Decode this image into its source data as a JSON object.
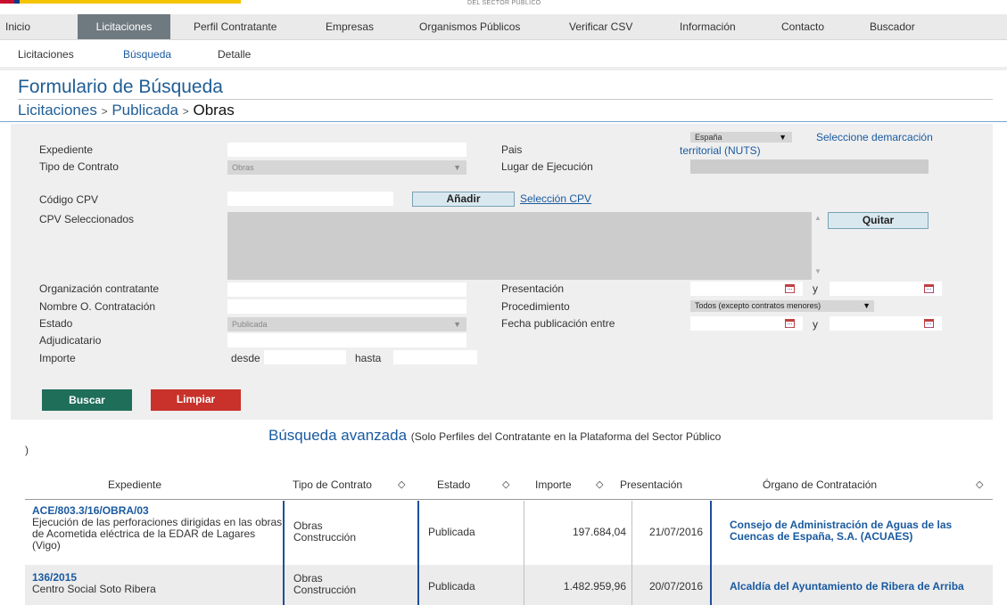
{
  "header": {
    "top_text": "DEL SECTOR PÚBLICO"
  },
  "main_nav": [
    "Inicio",
    "Licitaciones",
    "Perfil Contratante",
    "Empresas",
    "Organismos Públicos",
    "Verificar CSV",
    "Información",
    "Contacto",
    "Buscador"
  ],
  "sub_nav": [
    "Licitaciones",
    "Búsqueda",
    "Detalle"
  ],
  "page": {
    "title": "Formulario de Búsqueda",
    "breadcrumb": [
      "Licitaciones",
      "Publicada",
      "Obras"
    ],
    "breadcrumb_sep": ">"
  },
  "form": {
    "expediente_label": "Expediente",
    "tipo_label": "Tipo de Contrato",
    "tipo_value": "Obras",
    "cpv_label": "Código CPV",
    "cpv_sel_label": "CPV Seleccionados",
    "add_button": "Añadir",
    "cpv_link": "Selección CPV",
    "remove_button": "Quitar",
    "pais_label": "Pais",
    "pais_value": "España",
    "demarcacion_link_1": "Seleccione demarcación",
    "demarcacion_link_2": "territorial (NUTS)",
    "lugar_label": "Lugar de Ejecución",
    "org_label": "Organización contratante",
    "nombre_label": "Nombre O. Contratación",
    "estado_label": "Estado",
    "estado_value": "Publicada",
    "adj_label": "Adjudicatario",
    "importe_label": "Importe",
    "desde": "desde",
    "hasta": "hasta",
    "presentacion_label": "Presentación",
    "procedimiento_label": "Procedimiento",
    "procedimiento_value": "Todos (excepto contratos menores)",
    "fecha_label": "Fecha publicación entre",
    "y": "y",
    "buscar": "Buscar",
    "limpiar": "Limpiar"
  },
  "advanced": {
    "link": "Búsqueda avanzada",
    "note": "(Solo Perfiles del Contratante en la Plataforma del Sector Público",
    "close": ")"
  },
  "table": {
    "headers": [
      "Expediente",
      "Tipo de Contrato",
      "Estado",
      "Importe",
      "Presentación",
      "Órgano de Contratación"
    ],
    "sort_glyph": "◇",
    "rows": [
      {
        "expediente": "ACE/803.3/16/OBRA/03",
        "descripcion": "Ejecución de las perforaciones dirigidas en las obras de Acometida eléctrica de la EDAR de Lagares (Vigo)",
        "tipo_1": "Obras",
        "tipo_2": "Construcción",
        "estado": "Publicada",
        "importe": "197.684,04",
        "presentacion": "21/07/2016",
        "organo": "Consejo de Administración de Aguas de las Cuencas de España, S.A. (ACUAES)"
      },
      {
        "expediente": "136/2015",
        "descripcion": "Centro Social Soto Ribera",
        "tipo_1": "Obras",
        "tipo_2": "Construcción",
        "estado": "Publicada",
        "importe": "1.482.959,96",
        "presentacion": "20/07/2016",
        "organo": "Alcaldía del Ayuntamiento de Ribera de Arriba"
      }
    ]
  }
}
